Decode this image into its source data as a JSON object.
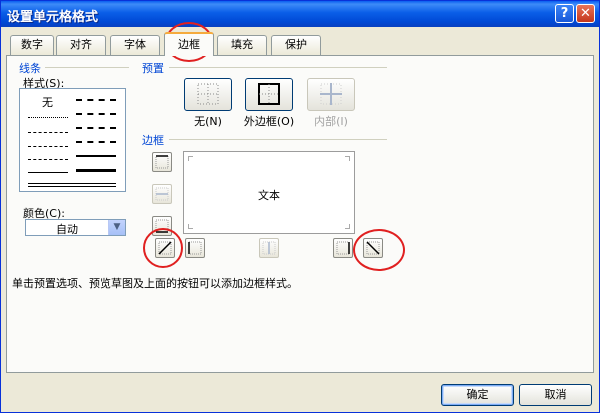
{
  "window": {
    "title": "设置单元格格式",
    "help": "?",
    "close": "✕"
  },
  "tabs": [
    "数字",
    "对齐",
    "字体",
    "边框",
    "填充",
    "保护"
  ],
  "line_group": {
    "label": "线条",
    "style_label": "样式(S):",
    "none_label": "无",
    "color_label": "颜色(C):",
    "color_value": "自动"
  },
  "preset_group": {
    "label": "预置",
    "items": [
      "无(N)",
      "外边框(O)",
      "内部(I)"
    ]
  },
  "border_group": {
    "label": "边框",
    "preview_text": "文本"
  },
  "hint": "单击预置选项、预览草图及上面的按钮可以添加边框样式。",
  "buttons": {
    "ok": "确定",
    "cancel": "取消"
  },
  "colors": {
    "group_label": "#0046d5",
    "highlight_circle": "#e02020",
    "title_bar": "#0a5ee8"
  }
}
